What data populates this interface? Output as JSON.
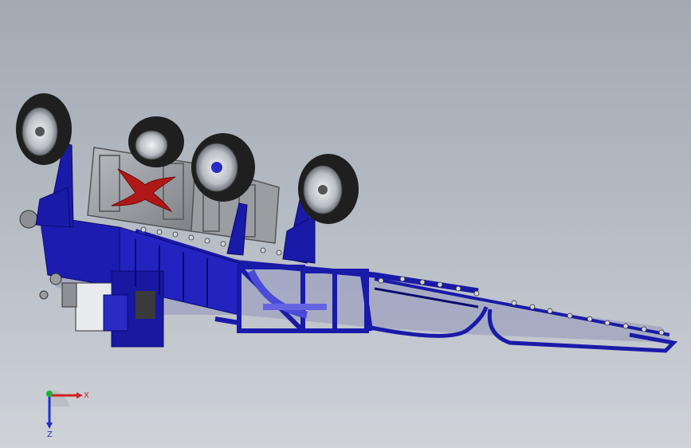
{
  "viewport": {
    "background_top": "#a3aab3",
    "background_bottom": "#cfd3d8"
  },
  "model": {
    "frame_color": "#1a1aa8",
    "frame_dark": "#0a0a6e",
    "frame_light": "#3d3dd0",
    "panel_color": "#8a8d92",
    "emblem_color": "#b01818",
    "tire_color": "#1f1f1f",
    "rim_color": "#c9ccd1"
  },
  "triad": {
    "x_label": "X",
    "z_label": "Z",
    "x_color": "#d42020",
    "y_color": "#1fae3a",
    "z_color": "#2430c8"
  }
}
